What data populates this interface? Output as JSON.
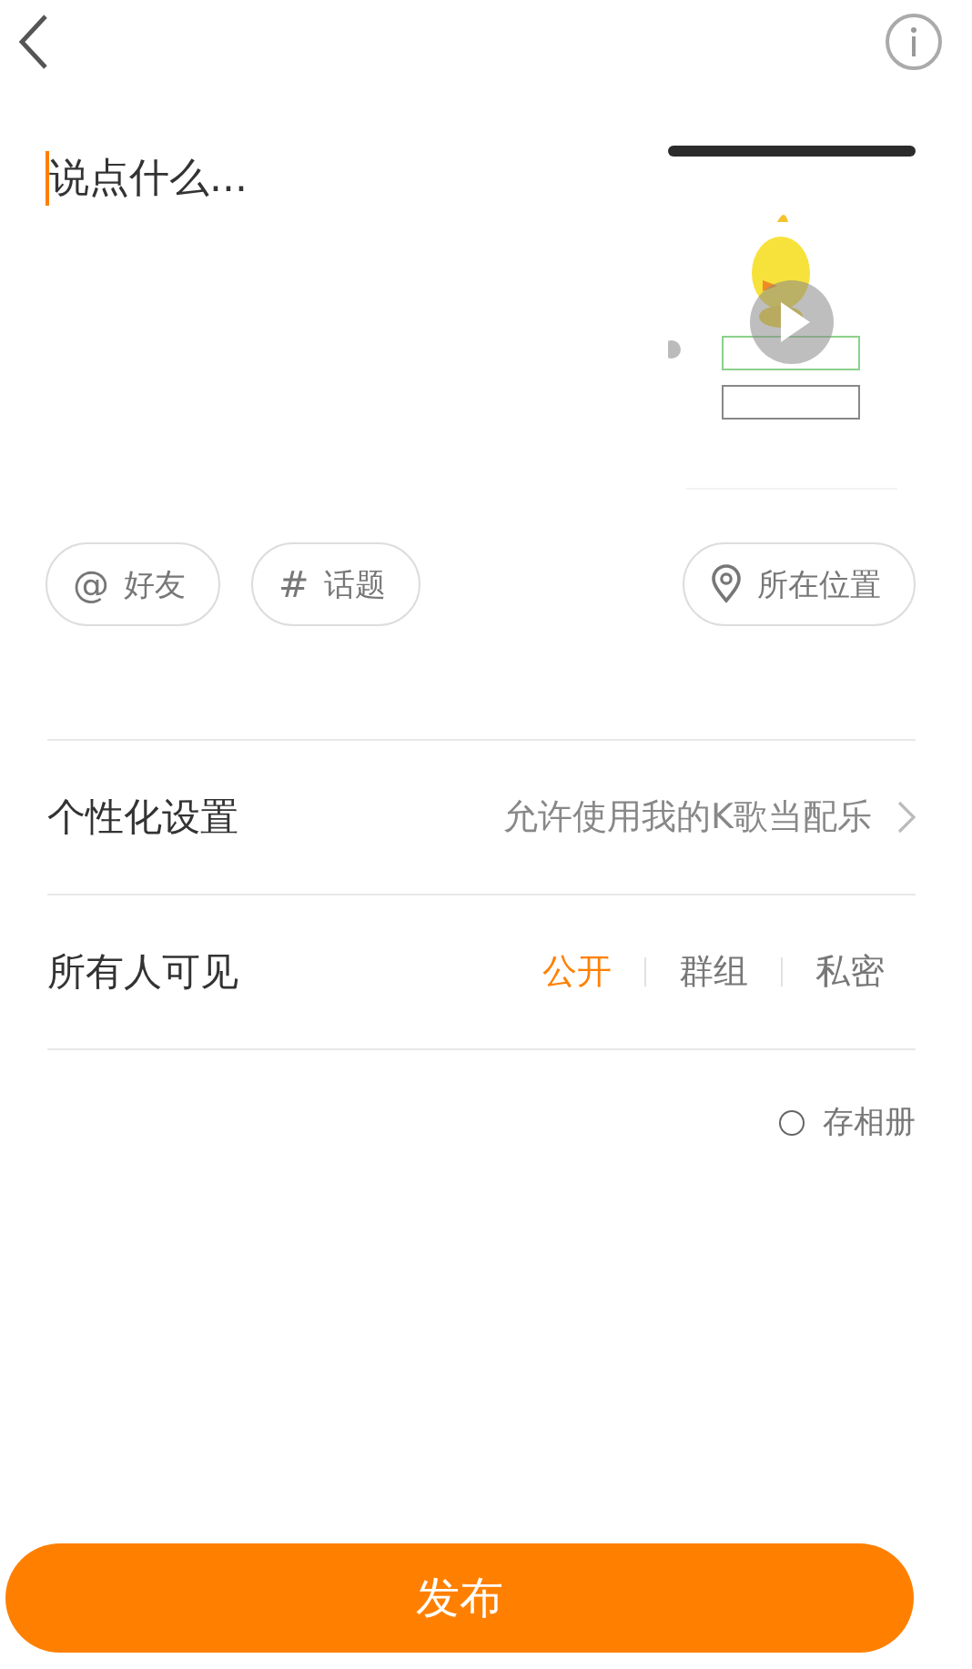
{
  "composer": {
    "placeholder": "说点什么..."
  },
  "chips": [
    {
      "kind": "symbol",
      "symbol": "@",
      "label": "好友"
    },
    {
      "kind": "symbol",
      "symbol": "#",
      "label": "话题"
    },
    {
      "kind": "location",
      "label": "所在位置"
    }
  ],
  "settings": {
    "label": "个性化设置",
    "value": "允许使用我的K歌当配乐"
  },
  "visibility": {
    "label": "所有人可见",
    "options": [
      {
        "label": "公开",
        "selected": true
      },
      {
        "label": "群组",
        "selected": false
      },
      {
        "label": "私密",
        "selected": false
      }
    ]
  },
  "save_to_album": {
    "label": "存相册",
    "checked": false
  },
  "publish_button": "发布"
}
